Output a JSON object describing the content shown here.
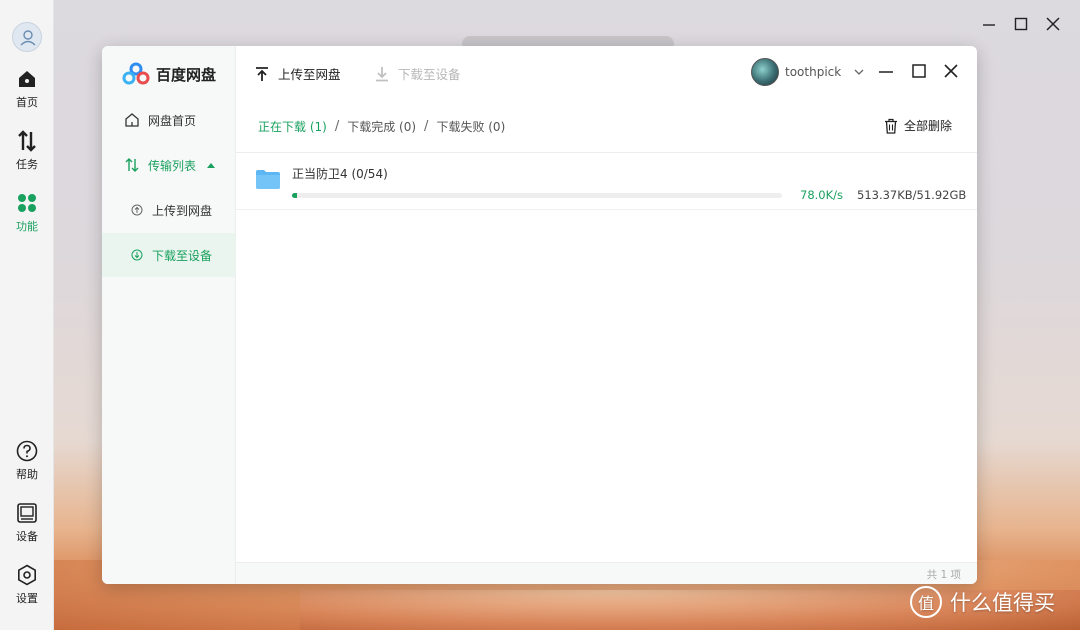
{
  "os": {
    "nav": [
      {
        "label": "首页",
        "icon": "home-icon"
      },
      {
        "label": "任务",
        "icon": "transfer-icon"
      },
      {
        "label": "功能",
        "icon": "apps-icon"
      }
    ],
    "bottom": [
      {
        "label": "帮助",
        "icon": "help-icon"
      },
      {
        "label": "设备",
        "icon": "device-icon"
      },
      {
        "label": "设置",
        "icon": "settings-icon"
      }
    ],
    "active_color": "#1aa15f"
  },
  "app": {
    "name": "百度网盘",
    "sidebar": {
      "home": "网盘首页",
      "transfer_list": "传输列表",
      "upload": "上传到网盘",
      "download": "下载至设备"
    },
    "toolbar": {
      "upload": "上传至网盘",
      "download": "下载至设备"
    },
    "user": {
      "name": "toothpick"
    },
    "tabs": {
      "downloading": "正在下载 (1)",
      "completed": "下载完成 (0)",
      "failed": "下载失败 (0)",
      "separator": "/"
    },
    "delete_all": "全部删除",
    "task": {
      "name": "正当防卫4 (0/54)",
      "speed": "78.0K/s",
      "size": "513.37KB/51.92GB",
      "progress": 0.01
    },
    "count": "共 1 项"
  },
  "watermark": {
    "logo": "值",
    "text": "什么值得买"
  }
}
